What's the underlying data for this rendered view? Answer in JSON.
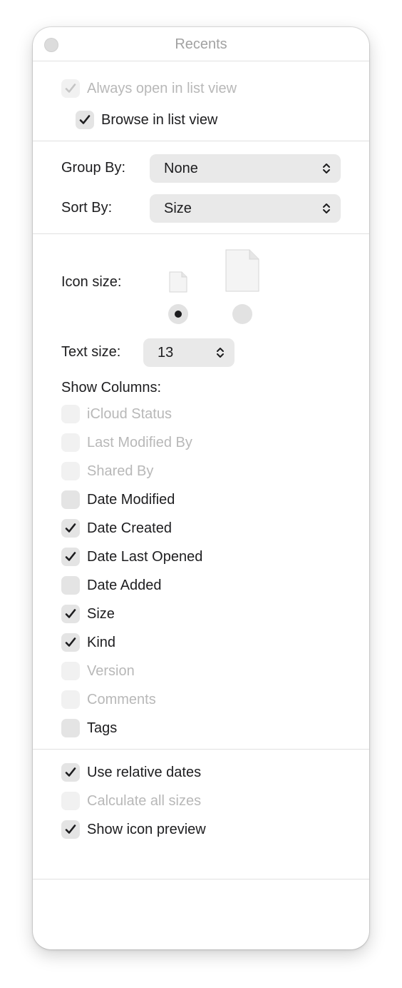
{
  "window": {
    "title": "Recents"
  },
  "top_options": [
    {
      "label": "Always open in list view",
      "checked": true,
      "disabled": true
    },
    {
      "label": "Browse in list view",
      "checked": true,
      "disabled": false
    }
  ],
  "group_by": {
    "label": "Group By:",
    "value": "None"
  },
  "sort_by": {
    "label": "Sort By:",
    "value": "Size"
  },
  "icon_size": {
    "label": "Icon size:",
    "selected": "small",
    "options": [
      "small",
      "large"
    ]
  },
  "text_size": {
    "label": "Text size:",
    "value": "13"
  },
  "show_columns": {
    "label": "Show Columns:",
    "items": [
      {
        "label": "iCloud Status",
        "checked": false,
        "disabled": true
      },
      {
        "label": "Last Modified By",
        "checked": false,
        "disabled": true
      },
      {
        "label": "Shared By",
        "checked": false,
        "disabled": true
      },
      {
        "label": "Date Modified",
        "checked": false,
        "disabled": false
      },
      {
        "label": "Date Created",
        "checked": true,
        "disabled": false
      },
      {
        "label": "Date Last Opened",
        "checked": true,
        "disabled": false
      },
      {
        "label": "Date Added",
        "checked": false,
        "disabled": false
      },
      {
        "label": "Size",
        "checked": true,
        "disabled": false
      },
      {
        "label": "Kind",
        "checked": true,
        "disabled": false
      },
      {
        "label": "Version",
        "checked": false,
        "disabled": true
      },
      {
        "label": "Comments",
        "checked": false,
        "disabled": true
      },
      {
        "label": "Tags",
        "checked": false,
        "disabled": false
      }
    ]
  },
  "bottom_options": [
    {
      "label": "Use relative dates",
      "checked": true,
      "disabled": false
    },
    {
      "label": "Calculate all sizes",
      "checked": false,
      "disabled": true
    },
    {
      "label": "Show icon preview",
      "checked": true,
      "disabled": false
    }
  ]
}
